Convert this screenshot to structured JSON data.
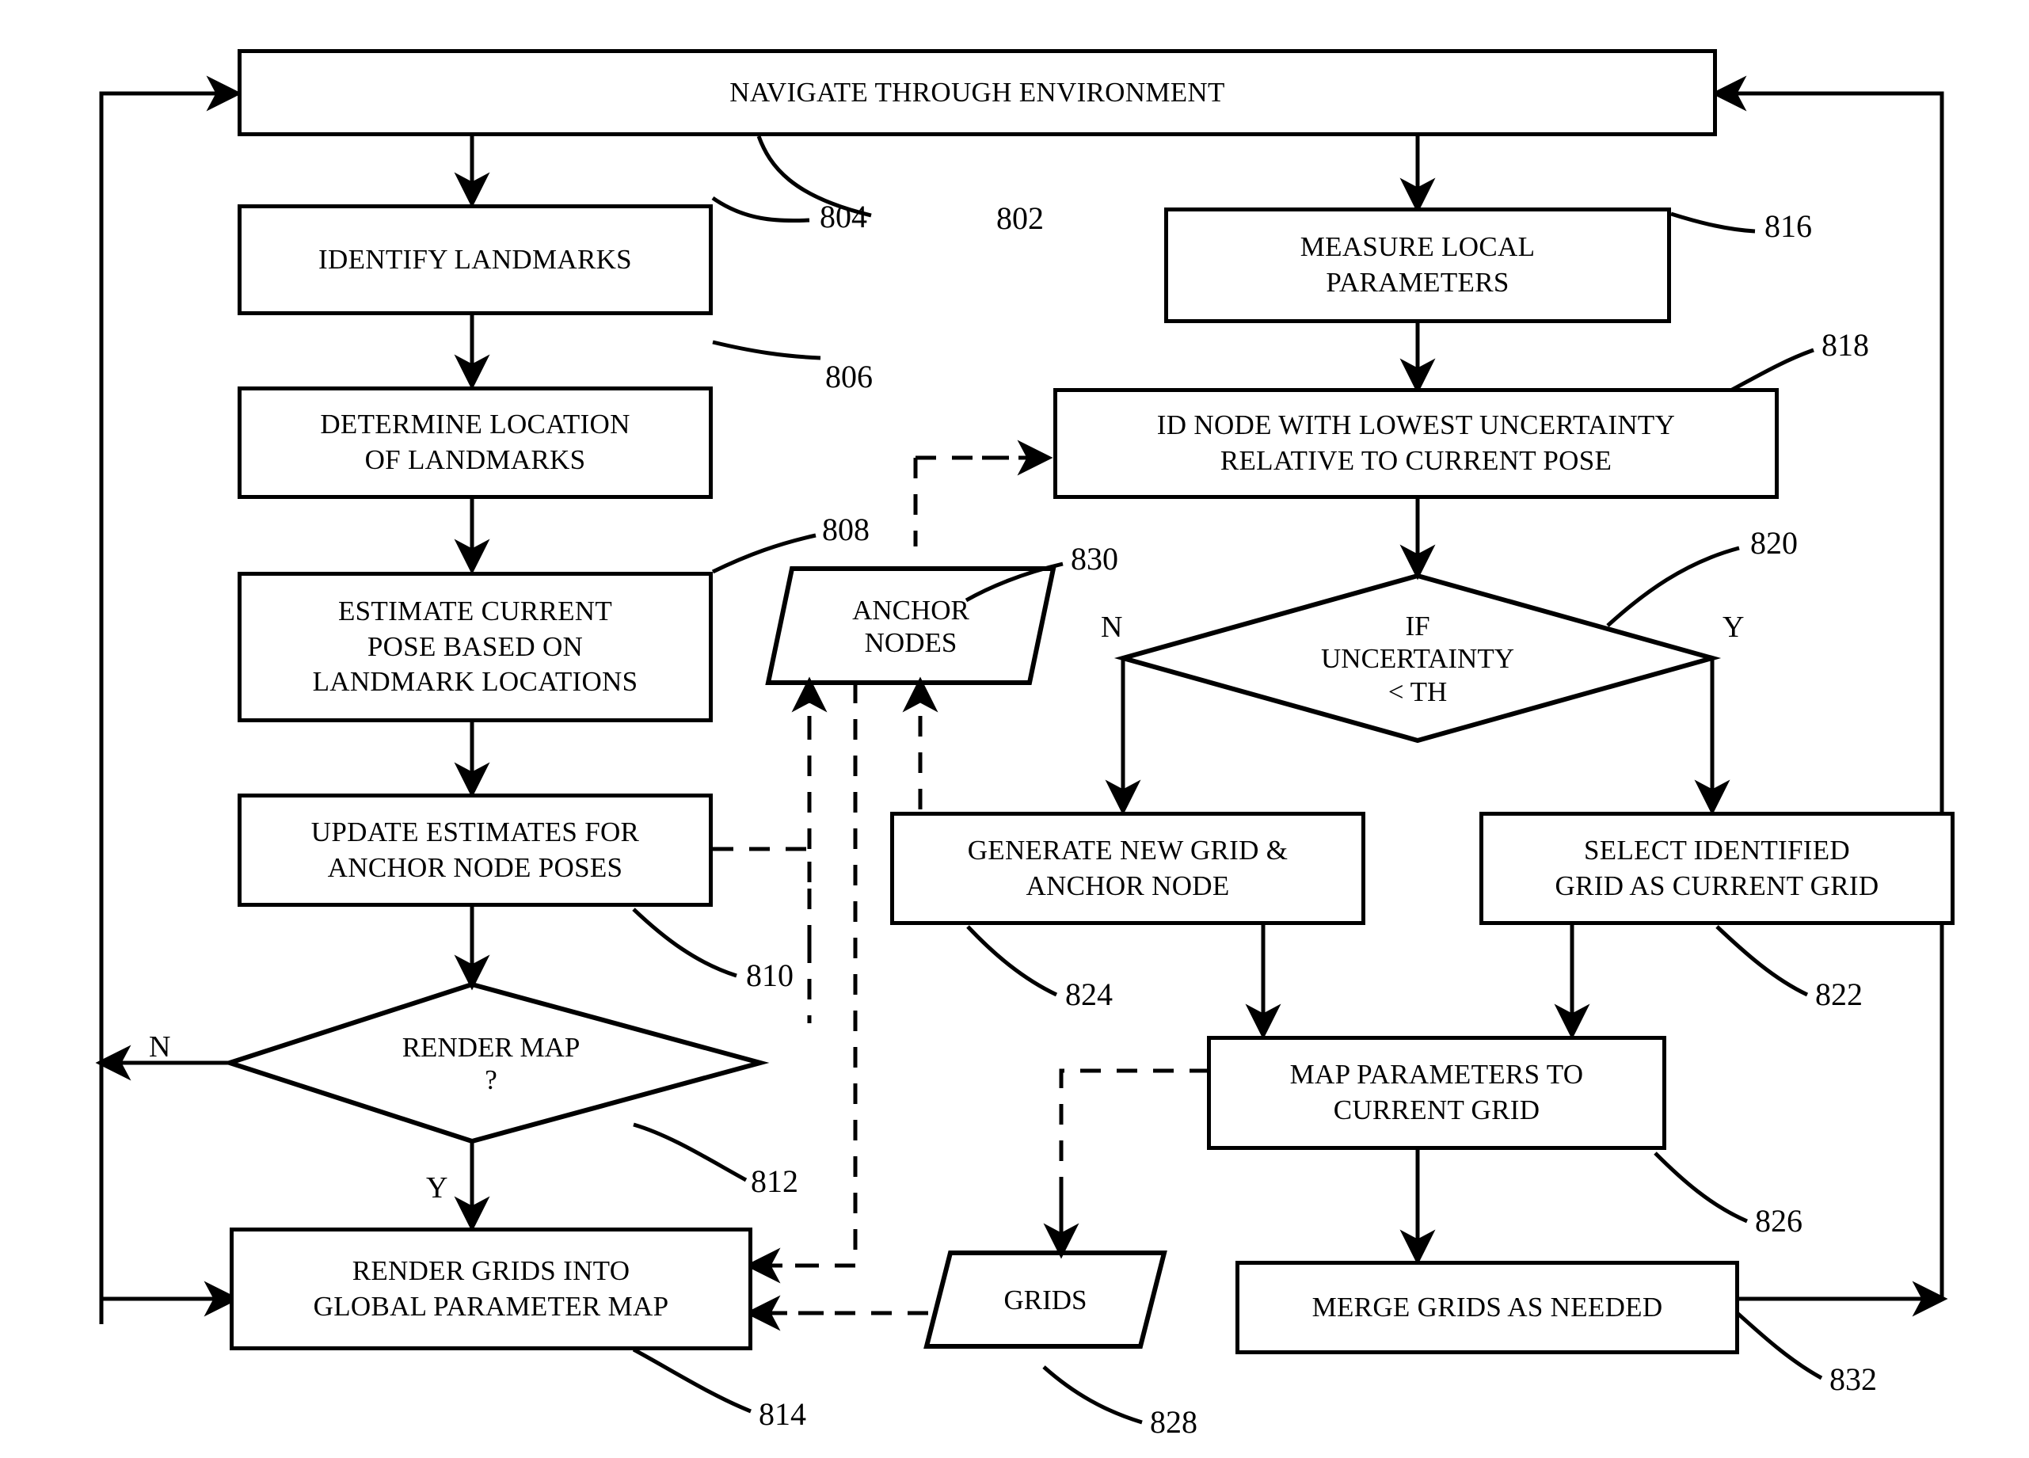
{
  "figure": {
    "title": "Navigation and mapping flowchart",
    "line_color": "#000000",
    "background": "#ffffff"
  },
  "nodes": [
    {
      "id": "n802",
      "shape": "process",
      "text": "NAVIGATE THROUGH ENVIRONMENT",
      "ref": "802"
    },
    {
      "id": "n804",
      "shape": "process",
      "text": "IDENTIFY LANDMARKS",
      "ref": "804"
    },
    {
      "id": "n806",
      "shape": "process",
      "line1": "DETERMINE LOCATION",
      "line2": "OF LANDMARKS",
      "ref": "806"
    },
    {
      "id": "n808",
      "shape": "process",
      "line1": "ESTIMATE CURRENT",
      "line2": "POSE BASED ON",
      "line3": "LANDMARK LOCATIONS",
      "ref": "808"
    },
    {
      "id": "n810",
      "shape": "process",
      "line1": "UPDATE ESTIMATES FOR",
      "line2": "ANCHOR NODE POSES",
      "ref": "810"
    },
    {
      "id": "n812",
      "shape": "decision",
      "line1": "RENDER MAP",
      "line2": "?",
      "ref": "812",
      "yes": "Y",
      "no": "N"
    },
    {
      "id": "n814",
      "shape": "process",
      "line1": "RENDER GRIDS INTO",
      "line2": "GLOBAL PARAMETER MAP",
      "ref": "814"
    },
    {
      "id": "n816",
      "shape": "process",
      "line1": "MEASURE LOCAL",
      "line2": "PARAMETERS",
      "ref": "816"
    },
    {
      "id": "n818",
      "shape": "process",
      "line1": "ID NODE WITH LOWEST UNCERTAINTY",
      "line2": "RELATIVE TO CURRENT POSE",
      "ref": "818"
    },
    {
      "id": "n820",
      "shape": "decision",
      "line1": "IF",
      "line2": "UNCERTAINTY",
      "line3": "< TH",
      "ref": "820",
      "yes": "Y",
      "no": "N"
    },
    {
      "id": "n822",
      "shape": "process",
      "line1": "SELECT IDENTIFIED",
      "line2": "GRID AS CURRENT GRID",
      "ref": "822"
    },
    {
      "id": "n824",
      "shape": "process",
      "line1": "GENERATE NEW GRID &",
      "line2": "ANCHOR NODE",
      "ref": "824"
    },
    {
      "id": "n826",
      "shape": "process",
      "line1": "MAP PARAMETERS TO",
      "line2": "CURRENT GRID",
      "ref": "826"
    },
    {
      "id": "n828",
      "shape": "data",
      "text": "GRIDS",
      "ref": "828"
    },
    {
      "id": "n830",
      "shape": "data",
      "line1": "ANCHOR",
      "line2": "NODES",
      "ref": "830"
    },
    {
      "id": "n832",
      "shape": "process",
      "text": "MERGE GRIDS AS NEEDED",
      "ref": "832"
    }
  ],
  "labels": {
    "n802_text": "NAVIGATE THROUGH ENVIRONMENT",
    "n804_text": "IDENTIFY LANDMARKS",
    "n806_l1": "DETERMINE LOCATION",
    "n806_l2": "OF LANDMARKS",
    "n808_l1": "ESTIMATE CURRENT",
    "n808_l2": "POSE BASED ON",
    "n808_l3": "LANDMARK LOCATIONS",
    "n810_l1": "UPDATE ESTIMATES FOR",
    "n810_l2": "ANCHOR NODE POSES",
    "n812_l1": "RENDER MAP",
    "n812_l2": "?",
    "n814_l1": "RENDER GRIDS INTO",
    "n814_l2": "GLOBAL PARAMETER MAP",
    "n816_l1": "MEASURE LOCAL",
    "n816_l2": "PARAMETERS",
    "n818_l1": "ID NODE WITH LOWEST UNCERTAINTY",
    "n818_l2": "RELATIVE TO CURRENT POSE",
    "n820_l1": "IF",
    "n820_l2": "UNCERTAINTY",
    "n820_l3": "< TH",
    "n822_l1": "SELECT IDENTIFIED",
    "n822_l2": "GRID AS CURRENT GRID",
    "n824_l1": "GENERATE NEW GRID &",
    "n824_l2": "ANCHOR NODE",
    "n826_l1": "MAP PARAMETERS TO",
    "n826_l2": "CURRENT GRID",
    "n828_text": "GRIDS",
    "n830_l1": "ANCHOR",
    "n830_l2": "NODES",
    "n832_text": "MERGE GRIDS AS NEEDED"
  },
  "refs": {
    "r802": "802",
    "r804": "804",
    "r806": "806",
    "r808": "808",
    "r810": "810",
    "r812": "812",
    "r814": "814",
    "r816": "816",
    "r818": "818",
    "r820": "820",
    "r822": "822",
    "r824": "824",
    "r826": "826",
    "r828": "828",
    "r830": "830",
    "r832": "832"
  },
  "branch_labels": {
    "uncertainty_no": "N",
    "uncertainty_yes": "Y",
    "render_no": "N",
    "render_yes": "Y"
  }
}
